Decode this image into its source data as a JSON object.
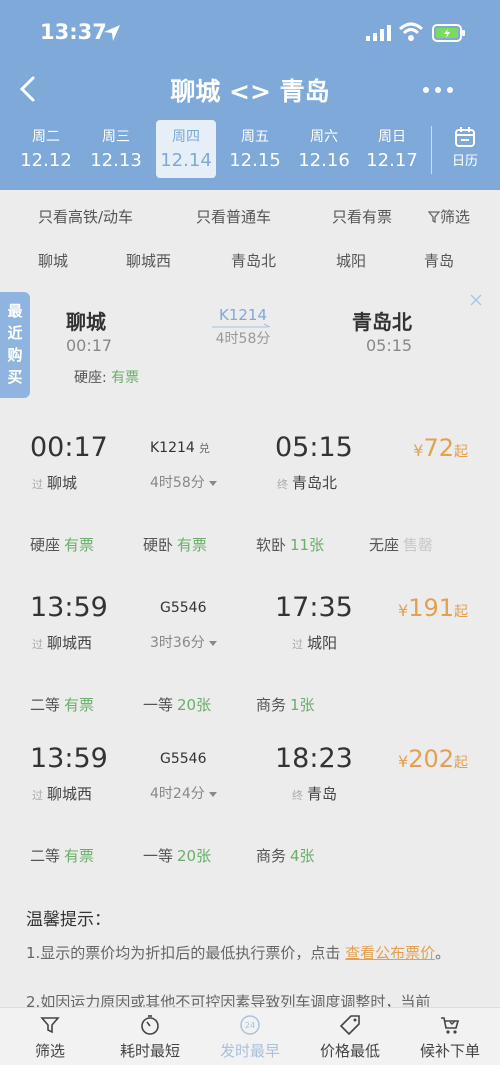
{
  "status_bar": {
    "time": "13:37"
  },
  "nav": {
    "title": "聊城 <> 青岛"
  },
  "dates": [
    {
      "weekday": "周二",
      "date": "12.12",
      "active": false
    },
    {
      "weekday": "周三",
      "date": "12.13",
      "active": false
    },
    {
      "weekday": "周四",
      "date": "12.14",
      "active": true
    },
    {
      "weekday": "周五",
      "date": "12.15",
      "active": false
    },
    {
      "weekday": "周六",
      "date": "12.16",
      "active": false
    },
    {
      "weekday": "周日",
      "date": "12.17",
      "active": false
    }
  ],
  "calendar_label": "日历",
  "filters": {
    "high_speed": "只看高铁/动车",
    "regular": "只看普通车",
    "available": "只看有票",
    "filter": "筛选"
  },
  "stations": [
    "聊城",
    "聊城西",
    "青岛北",
    "城阳",
    "青岛"
  ],
  "recent": {
    "tag": "最近购买",
    "from": "聊城",
    "from_time": "00:17",
    "train_no": "K1214",
    "duration": "4时58分",
    "to": "青岛北",
    "to_time": "05:15",
    "seat_label": "硬座:",
    "seat_status": "有票"
  },
  "trains": [
    {
      "dep_time": "00:17",
      "from_tag": "过",
      "from": "聊城",
      "train_no": "K1214",
      "exchange": "兑",
      "duration": "4时58分",
      "arr_time": "05:15",
      "to_tag": "终",
      "to": "青岛北",
      "price_currency": "¥",
      "price": "72",
      "price_suffix": "起",
      "seats": [
        {
          "type": "硬座",
          "status": "有票"
        },
        {
          "type": "硬卧",
          "status": "有票"
        },
        {
          "type": "软卧",
          "status": "11张"
        },
        {
          "type": "无座",
          "status": "售罄"
        }
      ]
    },
    {
      "dep_time": "13:59",
      "from_tag": "过",
      "from": "聊城西",
      "train_no": "G5546",
      "exchange": "",
      "duration": "3时36分",
      "arr_time": "17:35",
      "to_tag": "过",
      "to": "城阳",
      "price_currency": "¥",
      "price": "191",
      "price_suffix": "起",
      "seats": [
        {
          "type": "二等",
          "status": "有票"
        },
        {
          "type": "一等",
          "status": "20张"
        },
        {
          "type": "商务",
          "status": "1张"
        }
      ]
    },
    {
      "dep_time": "13:59",
      "from_tag": "过",
      "from": "聊城西",
      "train_no": "G5546",
      "exchange": "",
      "duration": "4时24分",
      "arr_time": "18:23",
      "to_tag": "终",
      "to": "青岛",
      "price_currency": "¥",
      "price": "202",
      "price_suffix": "起",
      "seats": [
        {
          "type": "二等",
          "status": "有票"
        },
        {
          "type": "一等",
          "status": "20张"
        },
        {
          "type": "商务",
          "status": "4张"
        }
      ]
    }
  ],
  "tips": {
    "title": "温馨提示：",
    "line1_prefix": "1.显示的票价均为折扣后的最低执行票价，点击",
    "line1_link": "查看公布票价",
    "line1_suffix": "。",
    "line2": "2.如因运力原因或其他不可控因素导致列车调度调整时，当前"
  },
  "bottom_bar": {
    "filter": "筛选",
    "shortest": "耗时最短",
    "earliest": "发时最早",
    "earliest_icon_text": "24",
    "cheapest": "价格最低",
    "waitlist": "候补下单"
  },
  "colors": {
    "header": "#7fa9d9",
    "price": "#e3a050",
    "available": "#6aae6a",
    "sold_out": "#c8c8c8"
  }
}
